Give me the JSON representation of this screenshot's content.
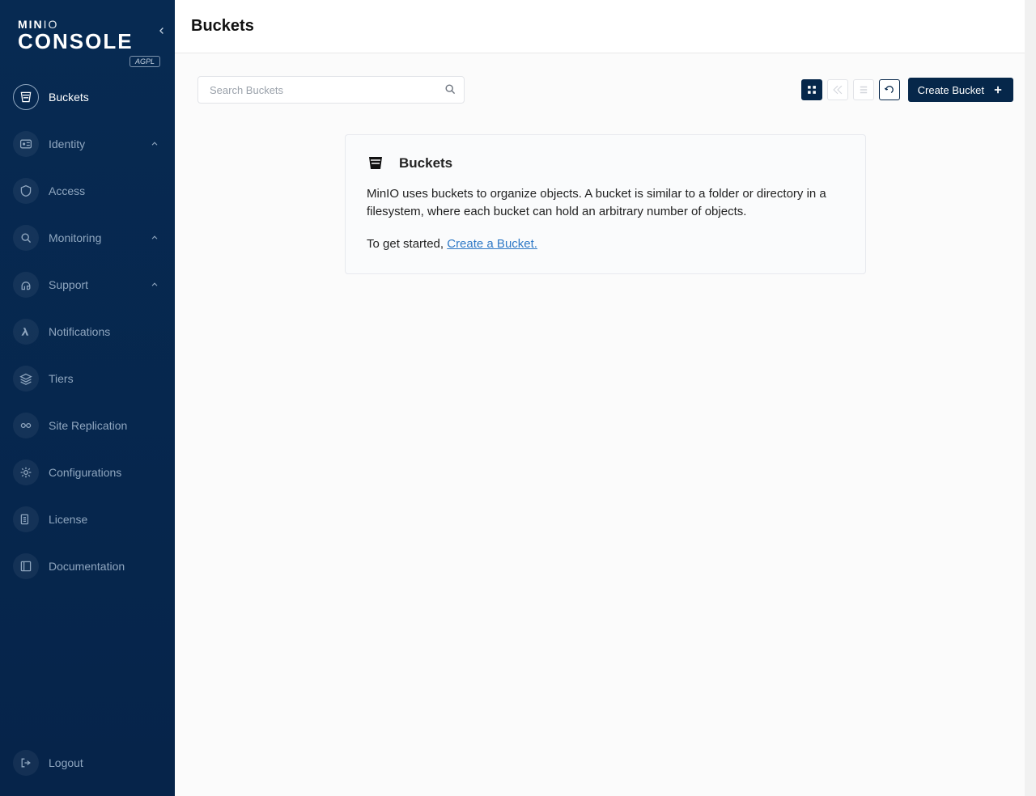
{
  "logo": {
    "brand_a": "MIN",
    "brand_b": "IO",
    "product": "CONSOLE",
    "license_badge": "AGPL"
  },
  "sidebar": {
    "items": [
      {
        "key": "buckets",
        "label": "Buckets",
        "icon": "bucket-icon",
        "active": true,
        "expandable": false
      },
      {
        "key": "identity",
        "label": "Identity",
        "icon": "id-card-icon",
        "active": false,
        "expandable": true
      },
      {
        "key": "access",
        "label": "Access",
        "icon": "shield-icon",
        "active": false,
        "expandable": false
      },
      {
        "key": "monitoring",
        "label": "Monitoring",
        "icon": "magnifier-icon",
        "active": false,
        "expandable": true
      },
      {
        "key": "support",
        "label": "Support",
        "icon": "headset-icon",
        "active": false,
        "expandable": true
      },
      {
        "key": "notifications",
        "label": "Notifications",
        "icon": "lambda-icon",
        "active": false,
        "expandable": false
      },
      {
        "key": "tiers",
        "label": "Tiers",
        "icon": "layers-icon",
        "active": false,
        "expandable": false
      },
      {
        "key": "site-rep",
        "label": "Site Replication",
        "icon": "replication-icon",
        "active": false,
        "expandable": false
      },
      {
        "key": "config",
        "label": "Configurations",
        "icon": "gear-icon",
        "active": false,
        "expandable": false
      },
      {
        "key": "license",
        "label": "License",
        "icon": "certificate-icon",
        "active": false,
        "expandable": false
      },
      {
        "key": "docs",
        "label": "Documentation",
        "icon": "book-icon",
        "active": false,
        "expandable": false
      }
    ],
    "footer": {
      "label": "Logout",
      "icon": "logout-icon"
    }
  },
  "header": {
    "title": "Buckets"
  },
  "toolbar": {
    "search_placeholder": "Search Buckets",
    "view_buttons": [
      {
        "key": "grid",
        "icon": "grid-icon",
        "state": "selected"
      },
      {
        "key": "rewind",
        "icon": "rewind-icon",
        "state": "disabled"
      },
      {
        "key": "list",
        "icon": "list-icon",
        "state": "disabled"
      },
      {
        "key": "refresh",
        "icon": "refresh-icon",
        "state": "normal"
      }
    ],
    "create_label": "Create Bucket"
  },
  "empty_state": {
    "title": "Buckets",
    "desc": "MinIO uses buckets to organize objects. A bucket is similar to a folder or directory in a filesystem, where each bucket can hold an arbitrary number of objects.",
    "cta_prefix": "To get started, ",
    "cta_link": "Create a Bucket."
  }
}
